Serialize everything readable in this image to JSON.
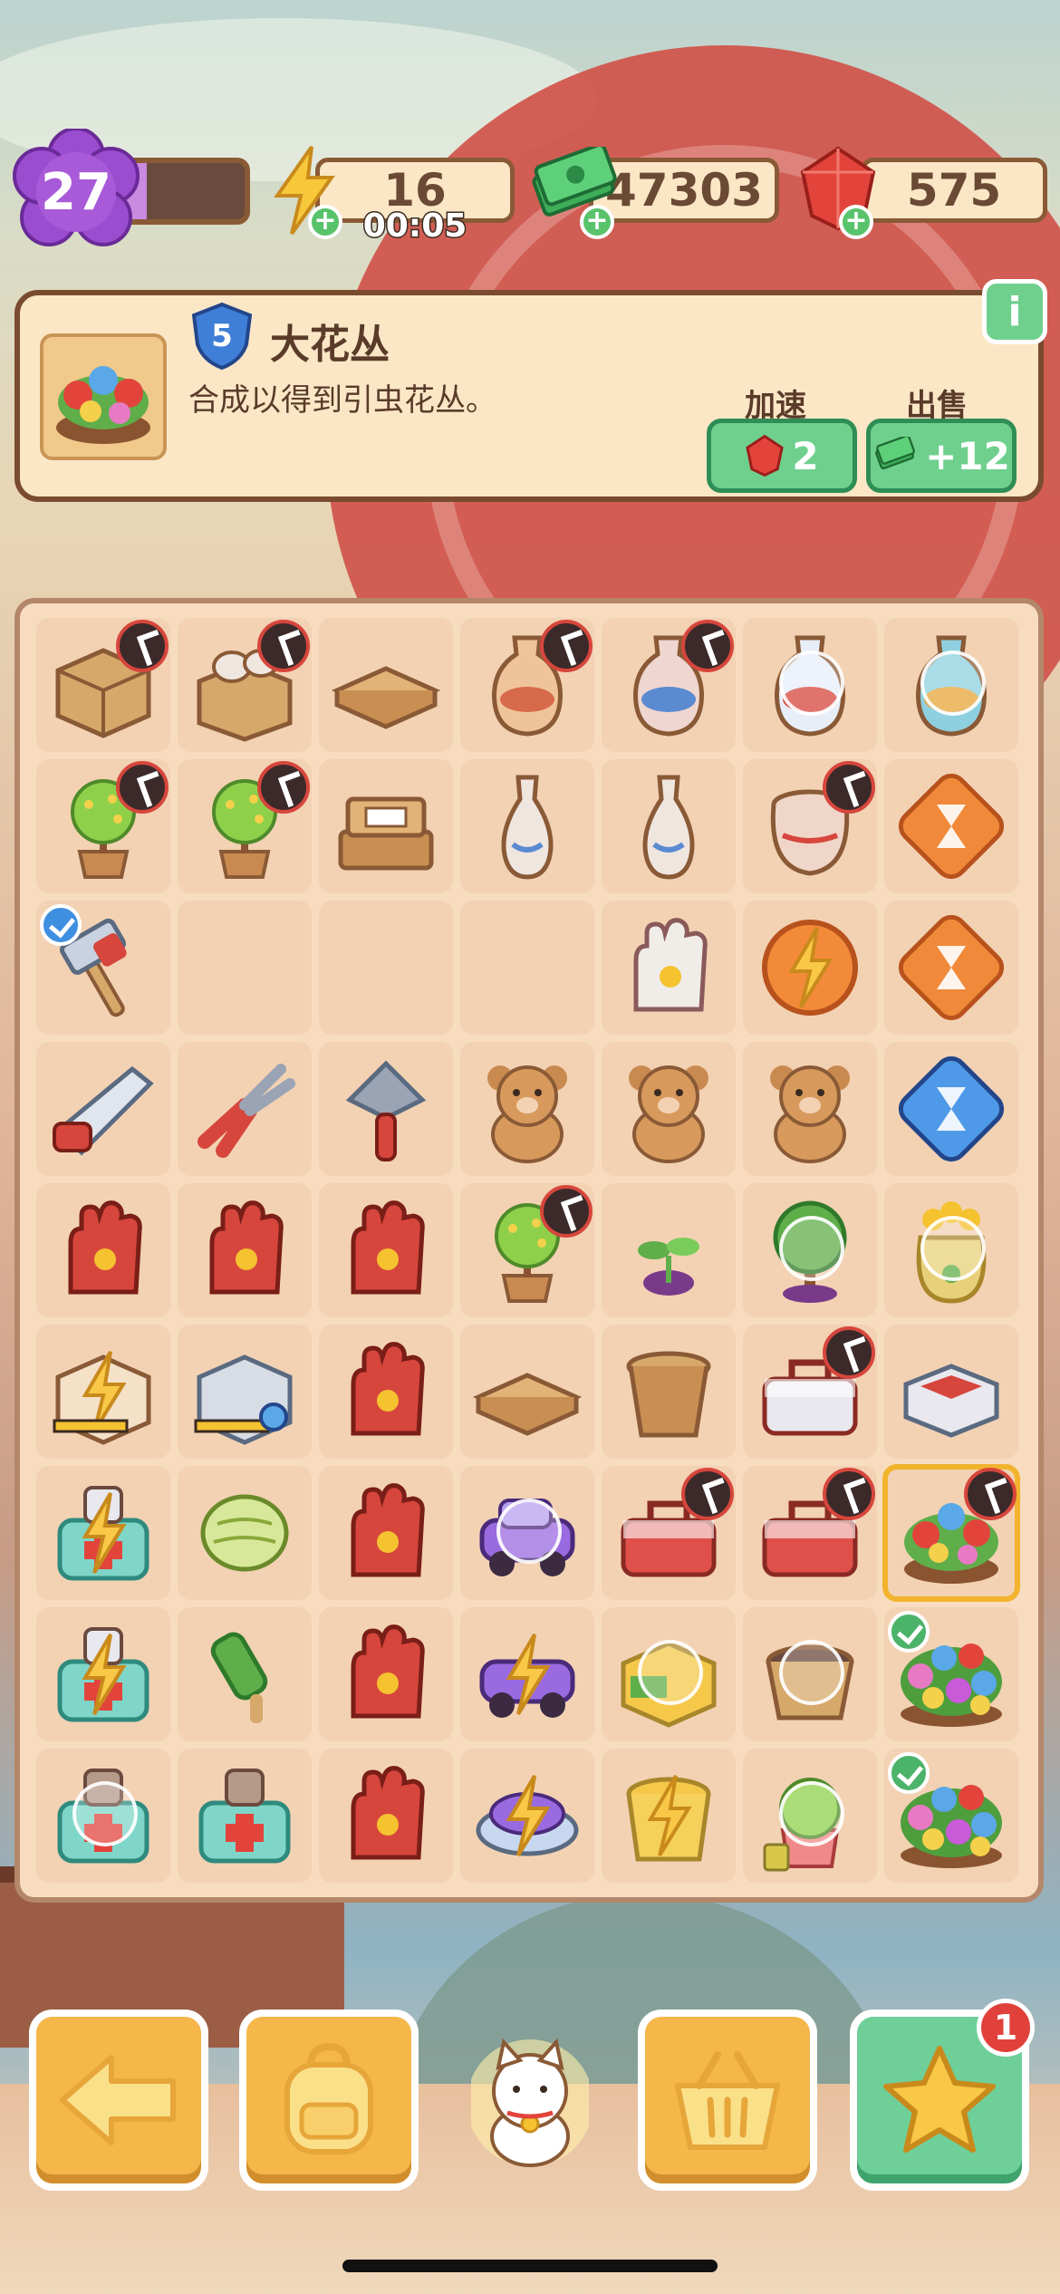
{
  "hud": {
    "level": "27",
    "level_progress_fraction": 0.25,
    "energy": "16",
    "energy_timer": "00:05",
    "cash": "47303",
    "gems": "575"
  },
  "info_panel": {
    "tier": "5",
    "title": "大花丛",
    "description": "合成以得到引虫花丛。",
    "speedup_label": "加速",
    "speedup_cost": "2",
    "sell_label": "出售",
    "sell_value": "+12",
    "info_icon": "i"
  },
  "bottom_bar": {
    "notification_count": "1"
  },
  "colors": {
    "accent_green": "#6fd08e",
    "accent_orange": "#f5b64a",
    "panel_bg": "#fbe7c6",
    "panel_border": "#7a4b2e",
    "gem_red": "#e0423b"
  },
  "board": [
    [
      {
        "item": "box-vases-icon",
        "timer": true
      },
      {
        "item": "open-box-vases-icon",
        "timer": true
      },
      {
        "item": "flat-boxes-icon"
      },
      {
        "item": "vase-icon",
        "timer": true
      },
      {
        "item": "blue-vase-icon",
        "timer": true
      },
      {
        "item": "ornate-vase-icon",
        "bubble": true
      },
      {
        "item": "dragon-vase-icon",
        "bubble": true
      }
    ],
    [
      {
        "item": "bonsai-tree-icon",
        "timer": true
      },
      {
        "item": "bonsai-tree-icon",
        "timer": true
      },
      {
        "item": "crate-stack-icon"
      },
      {
        "item": "slim-vase-icon"
      },
      {
        "item": "slim-vase-icon"
      },
      {
        "item": "clay-pot-icon",
        "timer": true
      },
      {
        "item": "hourglass-orange-icon"
      }
    ],
    [
      {
        "item": "hammer-icon",
        "check": true
      },
      {
        "item": "empty"
      },
      {
        "item": "empty"
      },
      {
        "item": "empty"
      },
      {
        "item": "glove-white-icon"
      },
      {
        "item": "energy-coin-icon"
      },
      {
        "item": "hourglass-orange-icon"
      }
    ],
    [
      {
        "item": "saw-icon"
      },
      {
        "item": "pliers-icon"
      },
      {
        "item": "trowel-icon"
      },
      {
        "item": "teddy-bear-icon"
      },
      {
        "item": "teddy-bear-icon"
      },
      {
        "item": "teddy-bear-honey-icon"
      },
      {
        "item": "hourglass-blue-icon"
      }
    ],
    [
      {
        "item": "red-glove-icon"
      },
      {
        "item": "red-glove-icon"
      },
      {
        "item": "red-glove-icon"
      },
      {
        "item": "bonsai-tree-icon",
        "timer": true
      },
      {
        "item": "sprout-icon"
      },
      {
        "item": "tree-icon",
        "bubble": true
      },
      {
        "item": "gold-sack-icon",
        "bubble": true
      }
    ],
    [
      {
        "item": "energy-crate-icon"
      },
      {
        "item": "energy-crate-grey-icon"
      },
      {
        "item": "red-glove-icon"
      },
      {
        "item": "flat-boxes-icon"
      },
      {
        "item": "flower-pot-icon"
      },
      {
        "item": "toolbox-icon",
        "timer": true
      },
      {
        "item": "tray-icon"
      }
    ],
    [
      {
        "item": "medkit-energy-icon"
      },
      {
        "item": "melon-icon"
      },
      {
        "item": "red-glove-icon"
      },
      {
        "item": "purple-car-icon",
        "bubble": true
      },
      {
        "item": "red-toolbox-icon",
        "timer": true
      },
      {
        "item": "red-toolbox-icon",
        "timer": true
      },
      {
        "item": "flower-bush-icon",
        "timer": true,
        "selected": true
      }
    ],
    [
      {
        "item": "medkit-energy-icon"
      },
      {
        "item": "green-brush-icon"
      },
      {
        "item": "red-glove-icon"
      },
      {
        "item": "purple-car-energy-icon"
      },
      {
        "item": "yellow-chest-icon",
        "bubble": true
      },
      {
        "item": "soil-pot-icon",
        "bubble": true
      },
      {
        "item": "big-flower-bush-icon",
        "check": true
      }
    ],
    [
      {
        "item": "medkit-icon",
        "bubble": true
      },
      {
        "item": "medkit-icon"
      },
      {
        "item": "red-glove-icon"
      },
      {
        "item": "hover-car-energy-icon"
      },
      {
        "item": "yellow-bucket-energy-icon"
      },
      {
        "item": "potted-plant-icon",
        "bubble": true
      },
      {
        "item": "big-flower-bush-icon",
        "check": true
      }
    ]
  ]
}
